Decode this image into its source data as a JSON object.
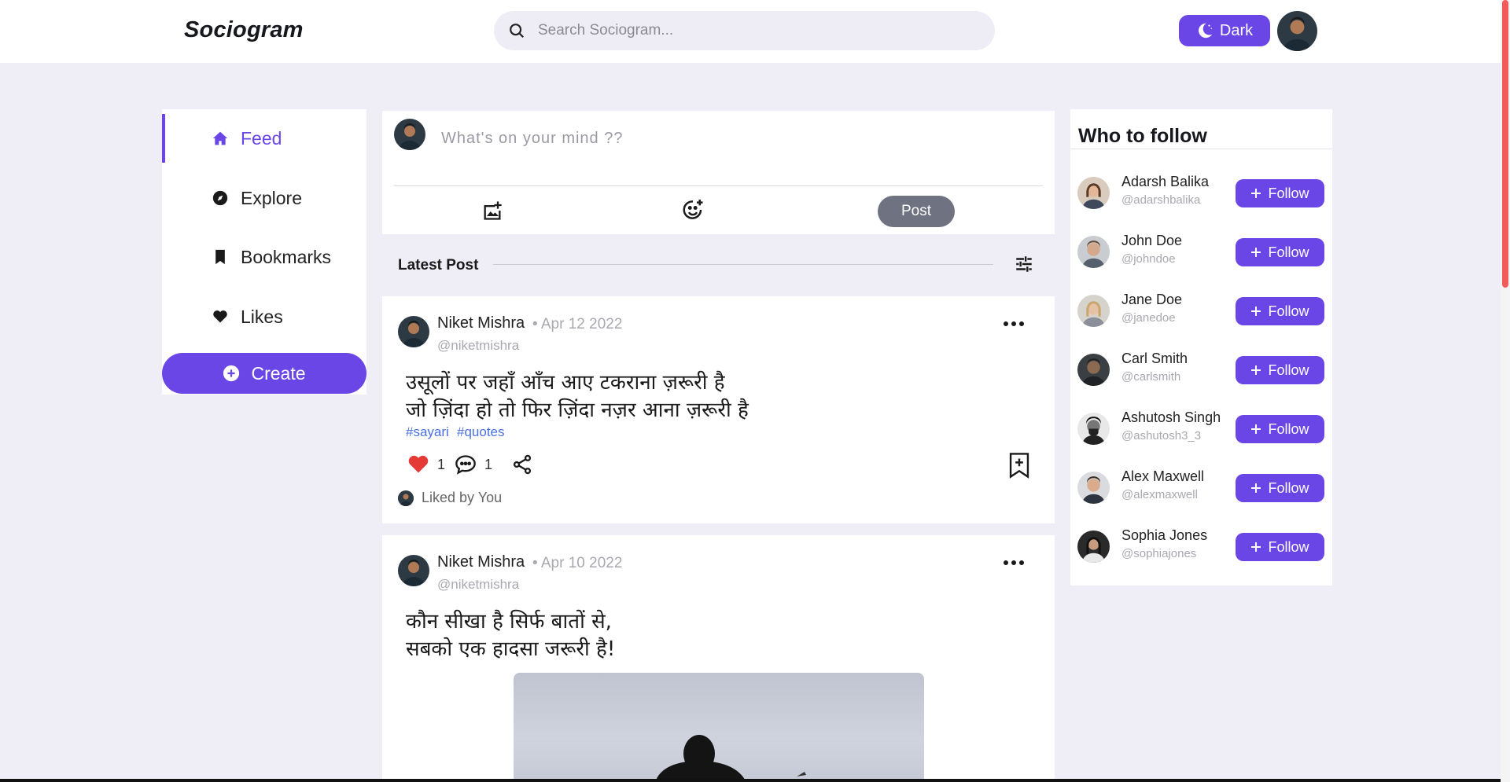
{
  "app": {
    "name": "Sociogram"
  },
  "search": {
    "placeholder": "Search Sociogram..."
  },
  "theme_toggle": {
    "label": "Dark"
  },
  "colors": {
    "accent": "#6a46e6",
    "background": "#efeef6",
    "like": "#e53935",
    "link": "#4a6fe3"
  },
  "nav": {
    "items": [
      {
        "label": "Feed",
        "icon": "home-icon",
        "active": true
      },
      {
        "label": "Explore",
        "icon": "compass-icon",
        "active": false
      },
      {
        "label": "Bookmarks",
        "icon": "bookmark-icon",
        "active": false
      },
      {
        "label": "Likes",
        "icon": "heart-icon",
        "active": false
      }
    ],
    "create_label": "Create"
  },
  "composer": {
    "placeholder": "What's on your mind ??",
    "post_label": "Post"
  },
  "feed": {
    "header": "Latest Post"
  },
  "posts": [
    {
      "author": "Niket Mishra",
      "date": "• Apr 12 2022",
      "handle": "@niketmishra",
      "lines": [
        "उसूलों पर जहाँ आँच आए टकराना ज़रूरी है",
        "जो ज़िंदा हो तो फिर ज़िंदा नज़र आना ज़रूरी है"
      ],
      "tags": [
        "#sayari",
        "#quotes"
      ],
      "likes": "1",
      "comments": "1",
      "liked_by": "Liked by You"
    },
    {
      "author": "Niket Mishra",
      "date": "• Apr 10 2022",
      "handle": "@niketmishra",
      "lines": [
        "कौन सीखा है सिर्फ बातों से,",
        "सबको एक हादसा जरूरी है!"
      ]
    }
  ],
  "who_to_follow": {
    "title": "Who to follow",
    "follow_label": "Follow",
    "users": [
      {
        "name": "Adarsh Balika",
        "handle": "@adarshbalika"
      },
      {
        "name": "John Doe",
        "handle": "@johndoe"
      },
      {
        "name": "Jane Doe",
        "handle": "@janedoe"
      },
      {
        "name": "Carl Smith",
        "handle": "@carlsmith"
      },
      {
        "name": "Ashutosh Singh",
        "handle": "@ashutosh3_3"
      },
      {
        "name": "Alex Maxwell",
        "handle": "@alexmaxwell"
      },
      {
        "name": "Sophia Jones",
        "handle": "@sophiajones"
      }
    ]
  }
}
